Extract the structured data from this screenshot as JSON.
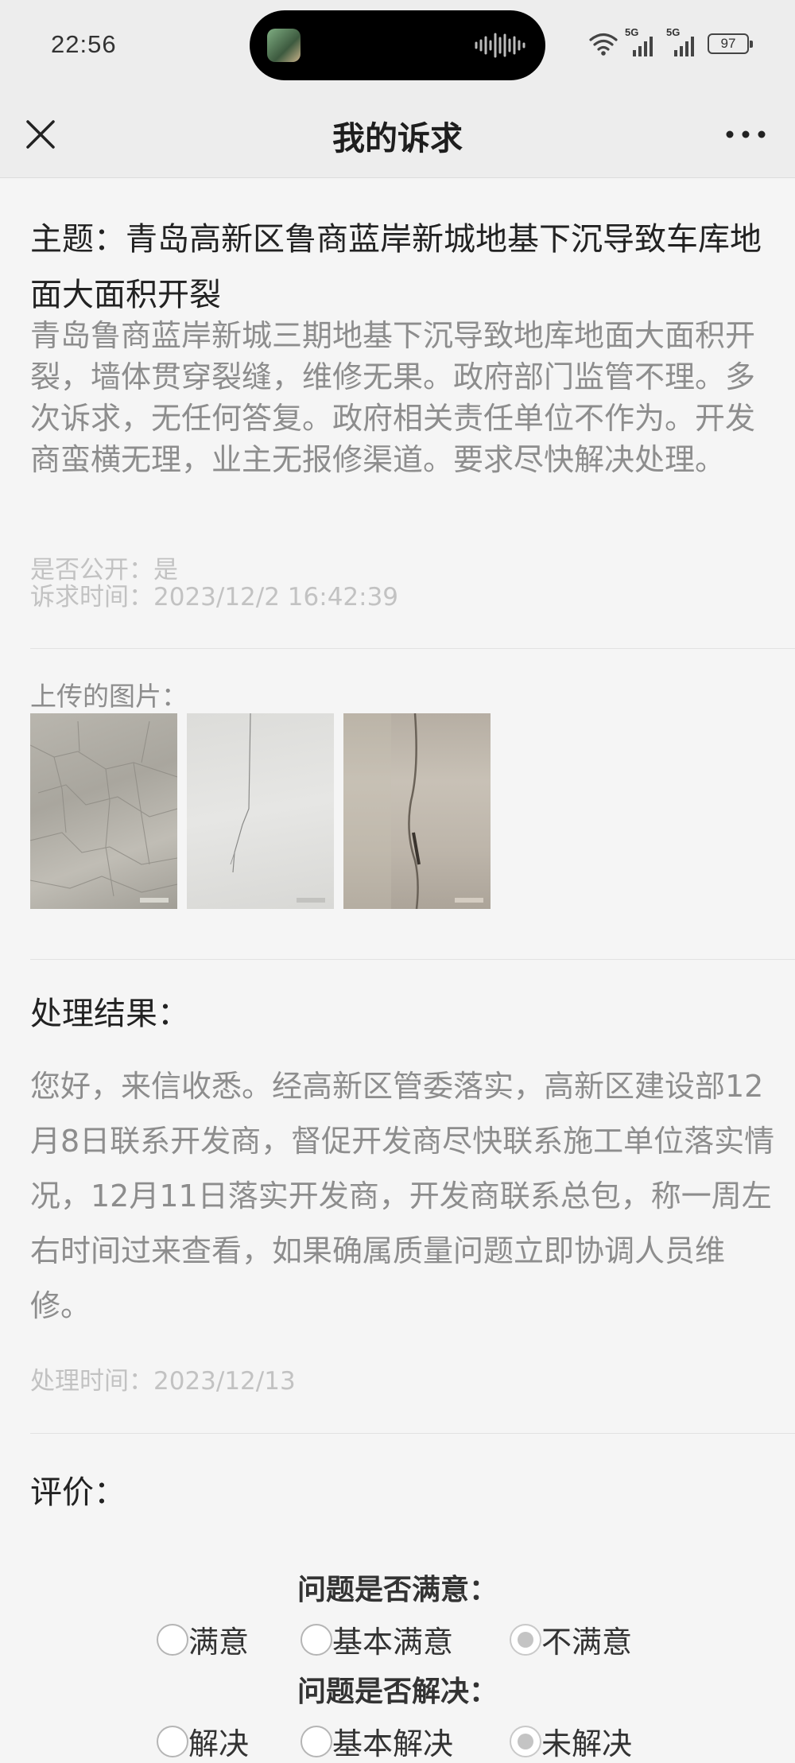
{
  "status_bar": {
    "time": "22:56",
    "battery": "97",
    "signal1_label": "5G",
    "signal2_label": "5G"
  },
  "nav": {
    "title": "我的诉求"
  },
  "petition": {
    "subject": "主题：青岛高新区鲁商蓝岸新城地基下沉导致车库地面大面积开裂",
    "description": "青岛鲁商蓝岸新城三期地基下沉导致地库地面大面积开裂，墙体贯穿裂缝，维修无果。政府部门监管不理。多次诉求，无任何答复。政府相关责任单位不作为。开发商蛮横无理，业主无报修渠道。要求尽快解决处理。",
    "public": "是否公开：是",
    "time": "诉求时间：2023/12/2 16:42:39",
    "uploaded_label": "上传的图片："
  },
  "result": {
    "label": "处理结果：",
    "text": "您好，来信收悉。经高新区管委落实，高新区建设部12月8日联系开发商，督促开发商尽快联系施工单位落实情况，12月11日落实开发商，开发商联系总包，称一周左右时间过来查看，如果确属质量问题立即协调人员维修。",
    "time": "处理时间：2023/12/13"
  },
  "evaluation": {
    "label": "评价：",
    "q1": {
      "title": "问题是否满意：",
      "options": [
        "满意",
        "基本满意",
        "不满意"
      ],
      "selected": "不满意"
    },
    "q2": {
      "title": "问题是否解决：",
      "options": [
        "解决",
        "基本解决",
        "未解决"
      ],
      "selected": "未解决"
    }
  }
}
